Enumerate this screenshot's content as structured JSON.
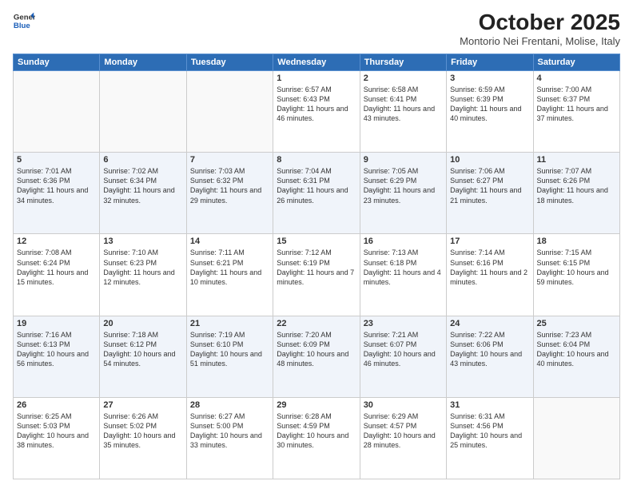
{
  "logo": {
    "line1": "General",
    "line2": "Blue"
  },
  "title": "October 2025",
  "subtitle": "Montorio Nei Frentani, Molise, Italy",
  "days_of_week": [
    "Sunday",
    "Monday",
    "Tuesday",
    "Wednesday",
    "Thursday",
    "Friday",
    "Saturday"
  ],
  "weeks": [
    [
      {
        "day": "",
        "text": ""
      },
      {
        "day": "",
        "text": ""
      },
      {
        "day": "",
        "text": ""
      },
      {
        "day": "1",
        "text": "Sunrise: 6:57 AM\nSunset: 6:43 PM\nDaylight: 11 hours and 46 minutes."
      },
      {
        "day": "2",
        "text": "Sunrise: 6:58 AM\nSunset: 6:41 PM\nDaylight: 11 hours and 43 minutes."
      },
      {
        "day": "3",
        "text": "Sunrise: 6:59 AM\nSunset: 6:39 PM\nDaylight: 11 hours and 40 minutes."
      },
      {
        "day": "4",
        "text": "Sunrise: 7:00 AM\nSunset: 6:37 PM\nDaylight: 11 hours and 37 minutes."
      }
    ],
    [
      {
        "day": "5",
        "text": "Sunrise: 7:01 AM\nSunset: 6:36 PM\nDaylight: 11 hours and 34 minutes."
      },
      {
        "day": "6",
        "text": "Sunrise: 7:02 AM\nSunset: 6:34 PM\nDaylight: 11 hours and 32 minutes."
      },
      {
        "day": "7",
        "text": "Sunrise: 7:03 AM\nSunset: 6:32 PM\nDaylight: 11 hours and 29 minutes."
      },
      {
        "day": "8",
        "text": "Sunrise: 7:04 AM\nSunset: 6:31 PM\nDaylight: 11 hours and 26 minutes."
      },
      {
        "day": "9",
        "text": "Sunrise: 7:05 AM\nSunset: 6:29 PM\nDaylight: 11 hours and 23 minutes."
      },
      {
        "day": "10",
        "text": "Sunrise: 7:06 AM\nSunset: 6:27 PM\nDaylight: 11 hours and 21 minutes."
      },
      {
        "day": "11",
        "text": "Sunrise: 7:07 AM\nSunset: 6:26 PM\nDaylight: 11 hours and 18 minutes."
      }
    ],
    [
      {
        "day": "12",
        "text": "Sunrise: 7:08 AM\nSunset: 6:24 PM\nDaylight: 11 hours and 15 minutes."
      },
      {
        "day": "13",
        "text": "Sunrise: 7:10 AM\nSunset: 6:23 PM\nDaylight: 11 hours and 12 minutes."
      },
      {
        "day": "14",
        "text": "Sunrise: 7:11 AM\nSunset: 6:21 PM\nDaylight: 11 hours and 10 minutes."
      },
      {
        "day": "15",
        "text": "Sunrise: 7:12 AM\nSunset: 6:19 PM\nDaylight: 11 hours and 7 minutes."
      },
      {
        "day": "16",
        "text": "Sunrise: 7:13 AM\nSunset: 6:18 PM\nDaylight: 11 hours and 4 minutes."
      },
      {
        "day": "17",
        "text": "Sunrise: 7:14 AM\nSunset: 6:16 PM\nDaylight: 11 hours and 2 minutes."
      },
      {
        "day": "18",
        "text": "Sunrise: 7:15 AM\nSunset: 6:15 PM\nDaylight: 10 hours and 59 minutes."
      }
    ],
    [
      {
        "day": "19",
        "text": "Sunrise: 7:16 AM\nSunset: 6:13 PM\nDaylight: 10 hours and 56 minutes."
      },
      {
        "day": "20",
        "text": "Sunrise: 7:18 AM\nSunset: 6:12 PM\nDaylight: 10 hours and 54 minutes."
      },
      {
        "day": "21",
        "text": "Sunrise: 7:19 AM\nSunset: 6:10 PM\nDaylight: 10 hours and 51 minutes."
      },
      {
        "day": "22",
        "text": "Sunrise: 7:20 AM\nSunset: 6:09 PM\nDaylight: 10 hours and 48 minutes."
      },
      {
        "day": "23",
        "text": "Sunrise: 7:21 AM\nSunset: 6:07 PM\nDaylight: 10 hours and 46 minutes."
      },
      {
        "day": "24",
        "text": "Sunrise: 7:22 AM\nSunset: 6:06 PM\nDaylight: 10 hours and 43 minutes."
      },
      {
        "day": "25",
        "text": "Sunrise: 7:23 AM\nSunset: 6:04 PM\nDaylight: 10 hours and 40 minutes."
      }
    ],
    [
      {
        "day": "26",
        "text": "Sunrise: 6:25 AM\nSunset: 5:03 PM\nDaylight: 10 hours and 38 minutes."
      },
      {
        "day": "27",
        "text": "Sunrise: 6:26 AM\nSunset: 5:02 PM\nDaylight: 10 hours and 35 minutes."
      },
      {
        "day": "28",
        "text": "Sunrise: 6:27 AM\nSunset: 5:00 PM\nDaylight: 10 hours and 33 minutes."
      },
      {
        "day": "29",
        "text": "Sunrise: 6:28 AM\nSunset: 4:59 PM\nDaylight: 10 hours and 30 minutes."
      },
      {
        "day": "30",
        "text": "Sunrise: 6:29 AM\nSunset: 4:57 PM\nDaylight: 10 hours and 28 minutes."
      },
      {
        "day": "31",
        "text": "Sunrise: 6:31 AM\nSunset: 4:56 PM\nDaylight: 10 hours and 25 minutes."
      },
      {
        "day": "",
        "text": ""
      }
    ]
  ]
}
